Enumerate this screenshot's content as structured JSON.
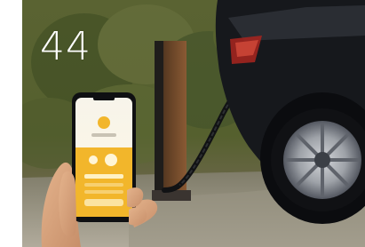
{
  "overlay": {
    "number": "44"
  },
  "photo": {
    "subject": "hand-holding-phone-ev-charger-car",
    "colors": {
      "foliage": "#4e5a2c",
      "ground": "#8f8d80",
      "car": "#16181c",
      "phone_screen_accent": "#f2b62b",
      "charger_post": "#7a4e2c"
    }
  }
}
